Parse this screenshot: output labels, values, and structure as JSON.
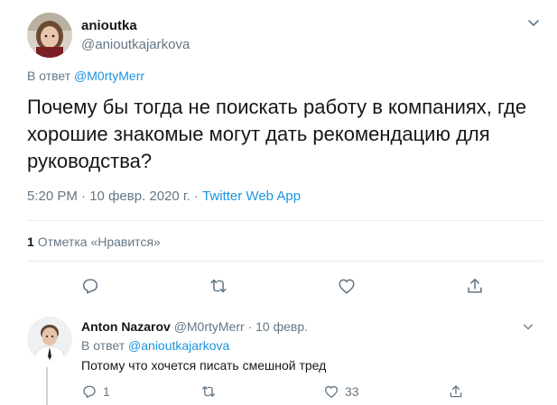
{
  "main_tweet": {
    "display_name": "anioutka",
    "handle": "@anioutkajarkova",
    "reply_prefix": "В ответ",
    "reply_mention": "@M0rtyMerr",
    "text": "Почему бы тогда не поискать работу в компаниях, где хорошие знакомые могут дать рекомендацию для руководства?",
    "time": "5:20 PM",
    "date": "10 февр. 2020 г.",
    "separator": "·",
    "source": "Twitter Web App",
    "likes_count": "1",
    "likes_label": "Отметка «Нравится»"
  },
  "reply_tweet": {
    "display_name": "Anton Nazarov",
    "handle": "@M0rtyMerr",
    "separator": "·",
    "date": "10 февр.",
    "reply_prefix": "В ответ",
    "reply_mention": "@anioutkajarkova",
    "text": "Потому что хочется писать смешной тред",
    "reply_count": "1",
    "like_count": "33"
  },
  "icons": {
    "reply": "comment-icon",
    "retweet": "retweet-icon",
    "like": "heart-icon",
    "share": "share-icon",
    "menu": "chevron-down-icon"
  },
  "colors": {
    "text": "#14171a",
    "secondary": "#657786",
    "link": "#1b95e0",
    "divider": "#e6ecf0"
  }
}
